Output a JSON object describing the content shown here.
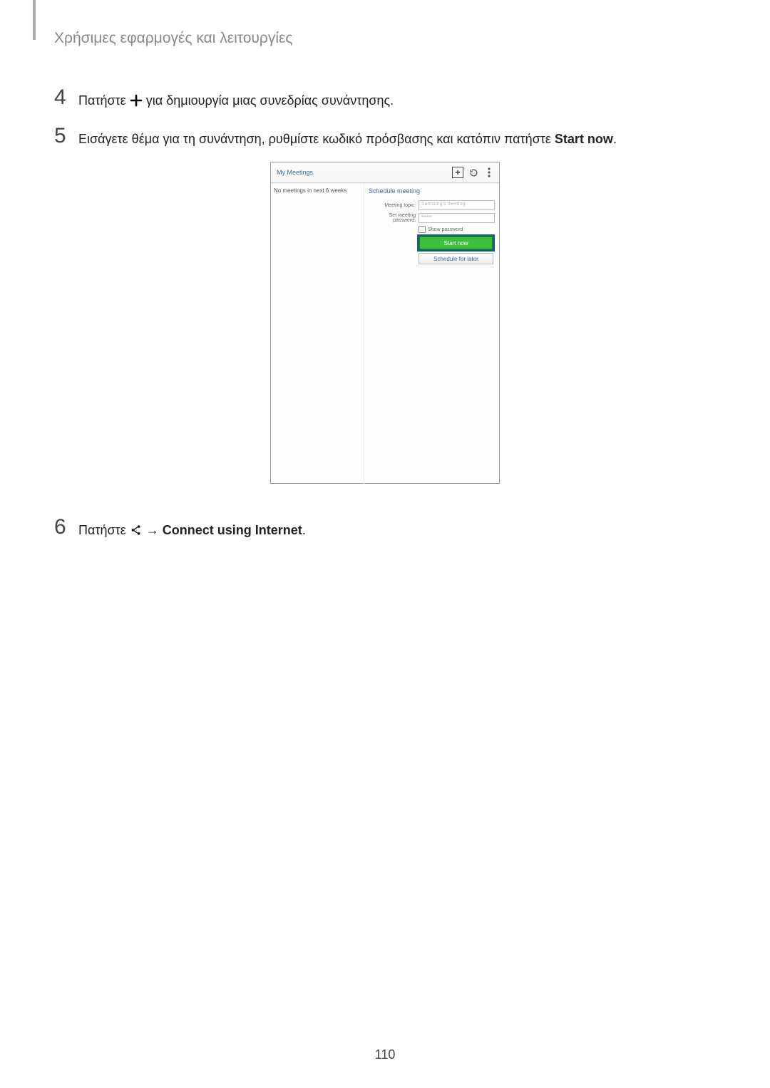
{
  "header": {
    "section_title": "Χρήσιμες εφαρμογές και λειτουργίες"
  },
  "steps": {
    "s4": {
      "num": "4",
      "pre": "Πατήστε ",
      "post": " για δημιουργία μιας συνεδρίας συνάντησης."
    },
    "s5": {
      "num": "5",
      "pre": "Εισάγετε θέμα για τη συνάντηση, ρυθμίστε κωδικό πρόσβασης και κατόπιν πατήστε ",
      "bold": "Start now",
      "post": "."
    },
    "s6": {
      "num": "6",
      "pre": "Πατήστε ",
      "arrow": " → ",
      "bold": "Connect using Internet",
      "post": "."
    }
  },
  "screenshot": {
    "topbar_title": "My Meetings",
    "left_text": "No meetings in next 6 weeks",
    "panel_title": "Schedule meeting",
    "topic_label": "Meeting topic:",
    "topic_value": "Samsung's meeting",
    "password_label": "Set meeting password:",
    "password_value": "••••••",
    "show_password": "Show password",
    "start_btn": "Start now",
    "schedule_btn": "Schedule for later"
  },
  "page_number": "110"
}
